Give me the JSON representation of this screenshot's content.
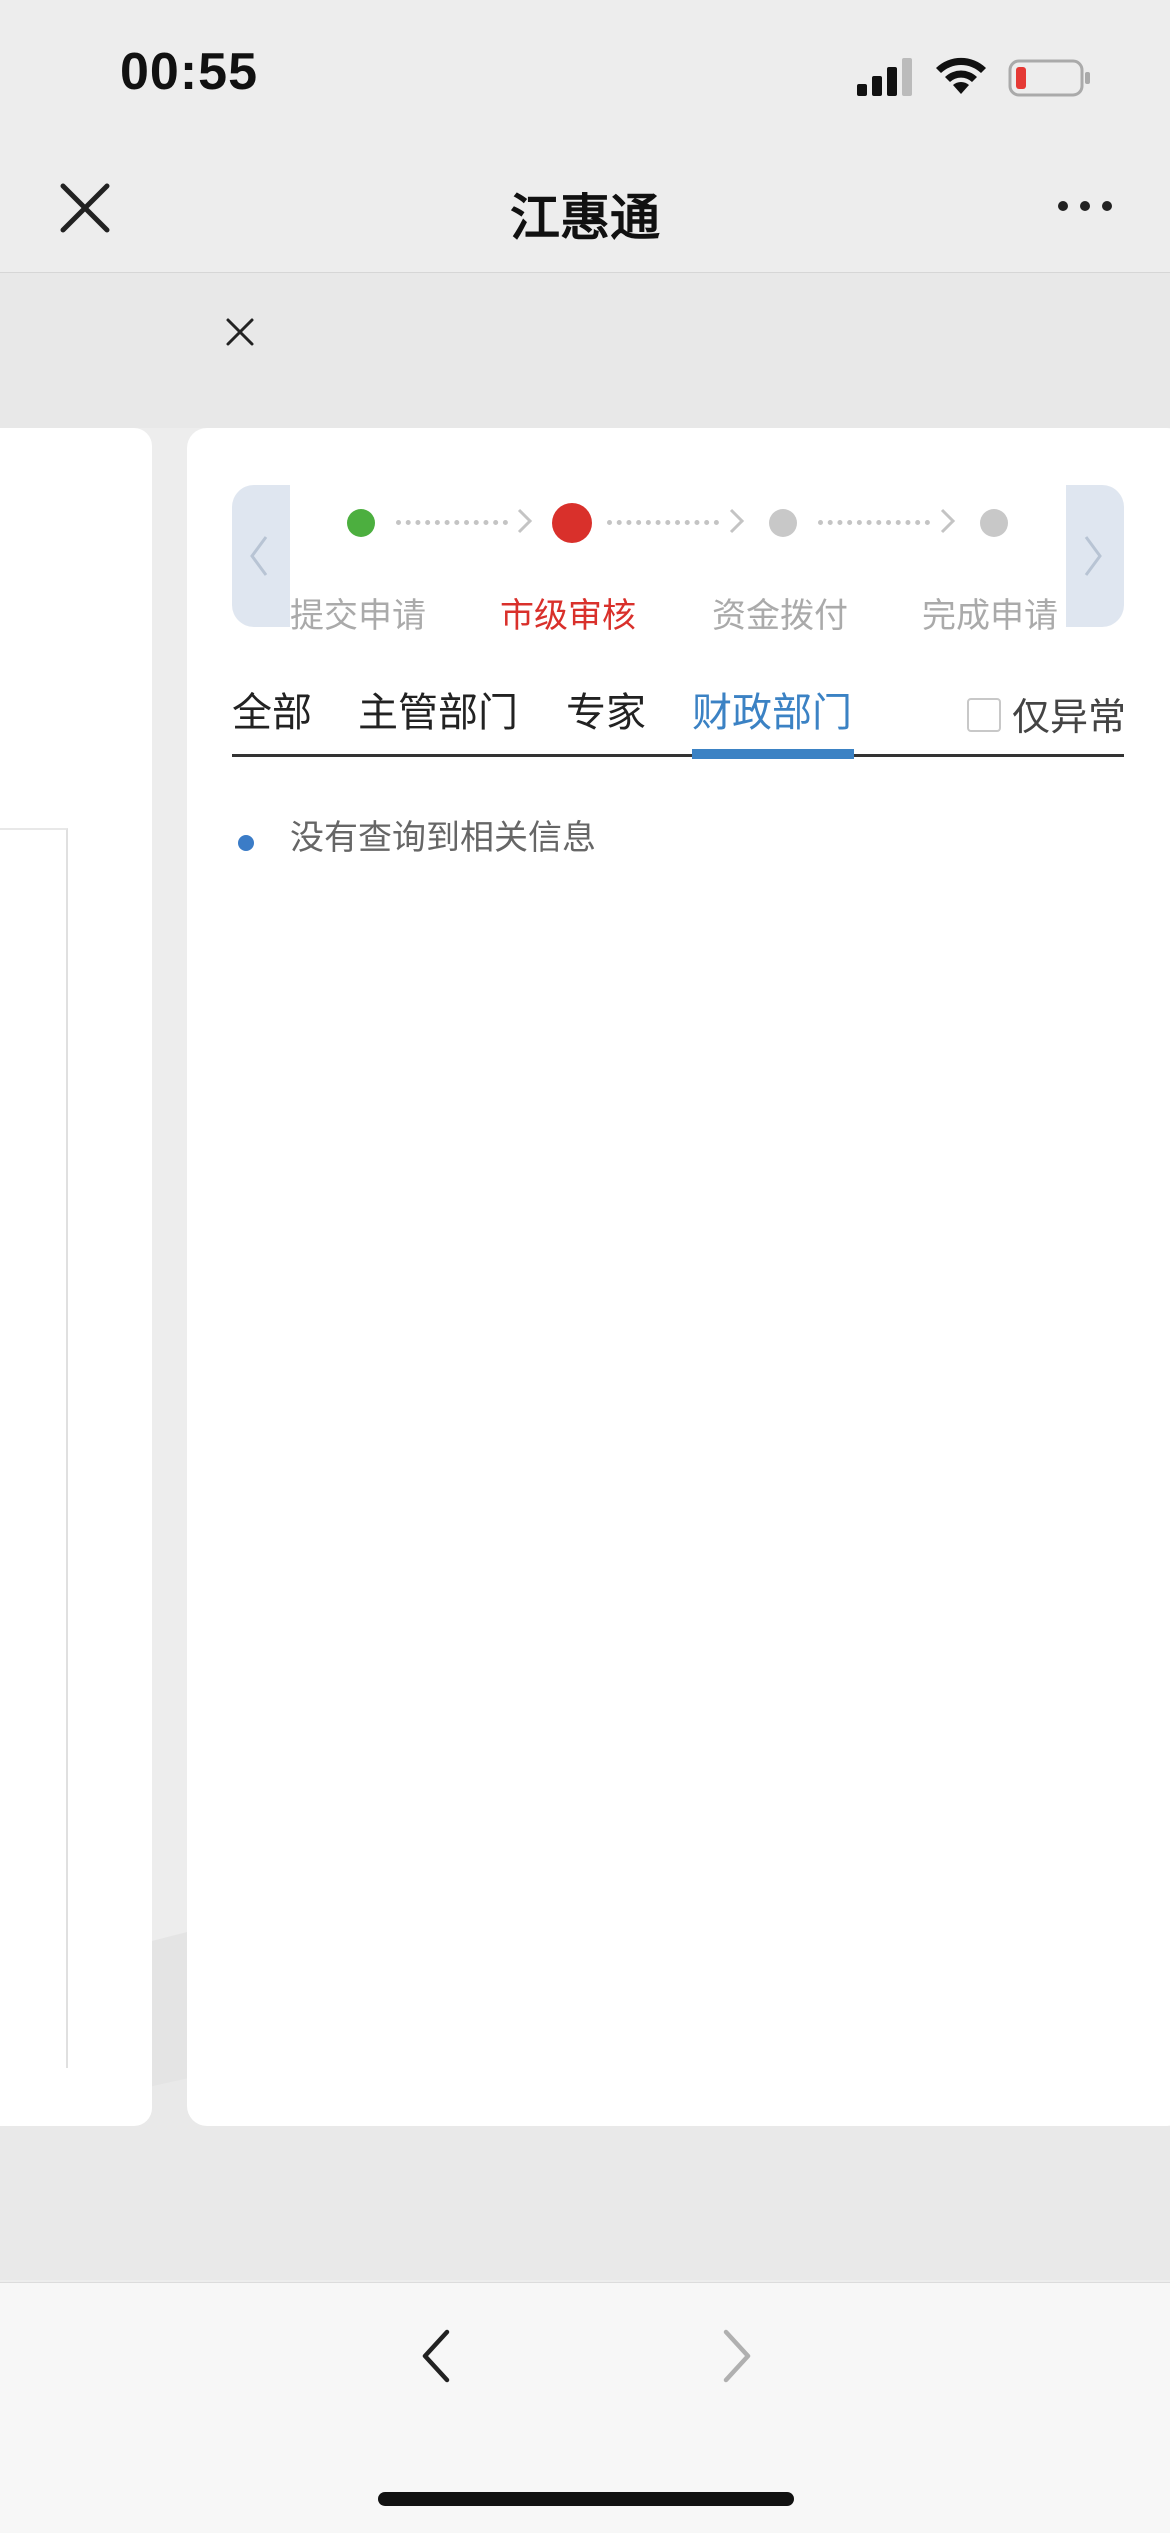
{
  "status_bar": {
    "time": "00:55"
  },
  "nav": {
    "title": "江惠通",
    "close_icon": "close-icon",
    "more_icon": "more-dots-icon"
  },
  "overlay": {
    "close_icon": "close-icon"
  },
  "steps": {
    "items": [
      {
        "label": "提交申请",
        "state": "done",
        "color": "#4caf3f"
      },
      {
        "label": "市级审核",
        "state": "current",
        "color": "#d9302b"
      },
      {
        "label": "资金拨付",
        "state": "pending",
        "color": "#c8c8c8"
      },
      {
        "label": "完成申请",
        "state": "pending",
        "color": "#c8c8c8"
      }
    ]
  },
  "tabs": {
    "items": [
      {
        "label": "全部"
      },
      {
        "label": "主管部门"
      },
      {
        "label": "专家"
      },
      {
        "label": "财政部门",
        "active": true
      }
    ],
    "filter": {
      "label": "仅异常",
      "checked": false
    }
  },
  "content": {
    "empty_message": "没有查询到相关信息"
  },
  "colors": {
    "accent": "#3b82c4",
    "current_step": "#d9302b",
    "done_step": "#4caf3f"
  }
}
